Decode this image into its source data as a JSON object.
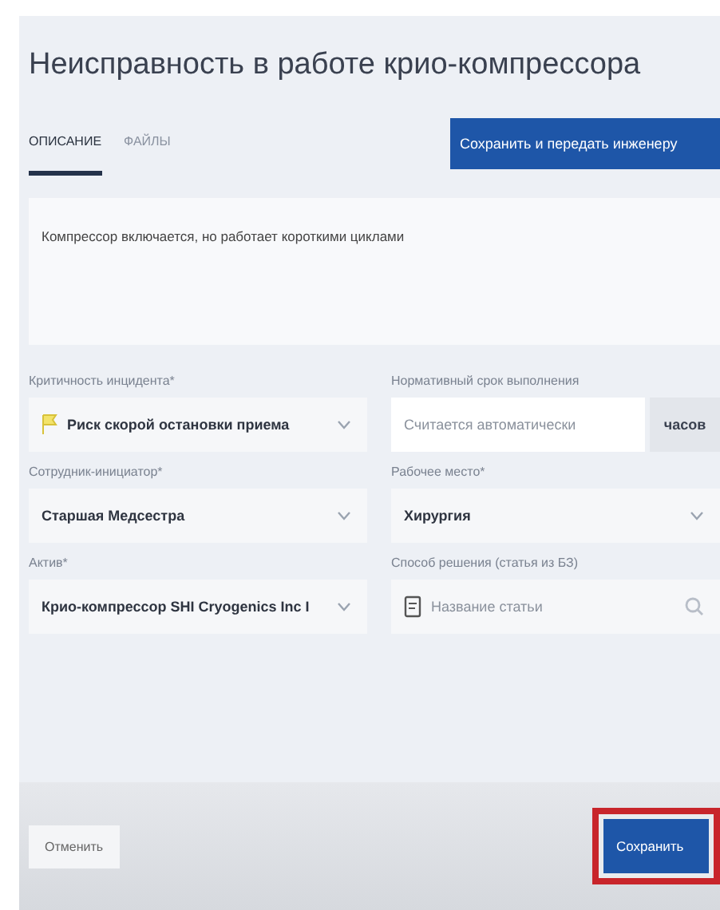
{
  "title": "Неисправность в работе крио-компрессора",
  "tabs": [
    {
      "label": "ОПИСАНИЕ",
      "selected": true
    },
    {
      "label": "ФАЙЛЫ",
      "selected": false
    }
  ],
  "primary_action": "Сохранить и передать инженеру",
  "description": "Компрессор включается, но работает короткими циклами",
  "fields": [
    {
      "kind": "priority-select",
      "label": "Критичность инцидента*",
      "value": "Риск скорой остановки приема"
    },
    {
      "kind": "unit-input",
      "label": "Нормативный срок выполнения",
      "placeholder": "Считается автоматически",
      "unit": "часов"
    },
    {
      "kind": "select",
      "label": "Сотрудник-инициатор*",
      "value": "Старшая Медсестра"
    },
    {
      "kind": "select",
      "label": "Рабочее место*",
      "value": "Хирургия"
    },
    {
      "kind": "select",
      "label": "Актив*",
      "value": "Крио-компрессор SHI Cryogenics Inc I"
    },
    {
      "kind": "article-search",
      "label": "Способ решения (статья из БЗ)",
      "placeholder": "Название статьи"
    }
  ],
  "footer": {
    "cancel": "Отменить",
    "save": "Сохранить",
    "save_highlighted": true
  }
}
